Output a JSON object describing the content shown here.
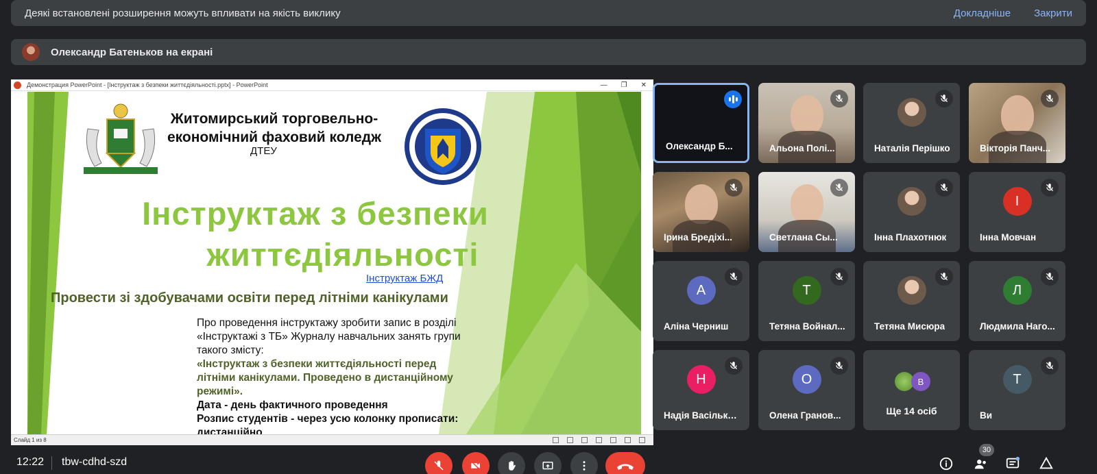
{
  "extension_banner": {
    "message": "Деякі встановлені розширення можуть впливати на якість виклику",
    "details_link": "Докладніше",
    "close_link": "Закрити"
  },
  "presenting_banner": {
    "message": "Олександр Батеньков на екрані"
  },
  "presentation": {
    "window_title": "Демонстрация PowerPoint - [Інструктаж з безпеки життєдіяльності.pptx] - PowerPoint",
    "status_text": "Слайд 1 из 8",
    "slide": {
      "college_line1": "Житомирський торговельно-",
      "college_line2": "економічний фаховий коледж",
      "college_short": "ДТЕУ",
      "title_line1": "Інструктаж з безпеки",
      "title_line2": "життєдіяльності",
      "link": "Інструктаж БЖД",
      "subtitle": "Провести зі здобувачами освіти перед літніми канікулами",
      "body_line1": "Про проведення інструктажу зробити запис в розділі",
      "body_line2": "«Інструктажі з ТБ» Журналу навчальних занять групи",
      "body_line3": "такого змісту:",
      "quote_line1": "«Інструктаж з безпеки життєдіяльності перед",
      "quote_line2": "літніми канікулами. Проведено в дистанційному",
      "quote_line3": "режимі».",
      "date_line": "Дата - день фактичного проведення",
      "sign_line1": "Розпис студентів - через усю колонку прописати:",
      "sign_line2": "дистанційно"
    }
  },
  "participants": [
    {
      "name": "Олександр Б...",
      "kind": "dark-video",
      "speaking": true
    },
    {
      "name": "Альона Полі...",
      "kind": "video",
      "muted": true
    },
    {
      "name": "Наталія Перішко",
      "kind": "photo-avatar",
      "muted": true
    },
    {
      "name": "Вікторія Панч...",
      "kind": "video",
      "muted": true
    },
    {
      "name": "Ірина Бредіхі...",
      "kind": "video",
      "muted": true
    },
    {
      "name": "Светлана Сы...",
      "kind": "video",
      "muted": true
    },
    {
      "name": "Інна Плахотнюк",
      "kind": "photo-avatar",
      "muted": true
    },
    {
      "name": "Інна Мовчан",
      "kind": "letter",
      "letter": "І",
      "color": "#d93025",
      "muted": true
    },
    {
      "name": "Аліна Черниш",
      "kind": "letter",
      "letter": "А",
      "color": "#5c6bc0",
      "muted": true
    },
    {
      "name": "Тетяна Войнал...",
      "kind": "letter",
      "letter": "Т",
      "color": "#33691e",
      "muted": true
    },
    {
      "name": "Тетяна Мисюра",
      "kind": "photo-avatar",
      "muted": true
    },
    {
      "name": "Людмила Наго...",
      "kind": "letter",
      "letter": "Л",
      "color": "#2e7d32",
      "muted": true
    },
    {
      "name": "Надія Васілько...",
      "kind": "letter",
      "letter": "Н",
      "color": "#e91e63",
      "muted": true
    },
    {
      "name": "Олена Гранов...",
      "kind": "letter",
      "letter": "О",
      "color": "#5c6bc0",
      "muted": true
    },
    {
      "name": "Ще 14 осіб",
      "kind": "more",
      "letter": "В",
      "color": "#7e57c2"
    },
    {
      "name": "Ви",
      "kind": "letter",
      "letter": "Т",
      "color": "#455a64",
      "muted": true
    }
  ],
  "bottom_bar": {
    "time": "12:22",
    "meeting_code": "tbw-cdhd-szd",
    "participant_count": "30"
  },
  "colors": {
    "background": "#202124",
    "banner": "#3c4043",
    "link": "#8ab4f8",
    "danger": "#ea4335",
    "active_border": "#8ab4f8"
  }
}
